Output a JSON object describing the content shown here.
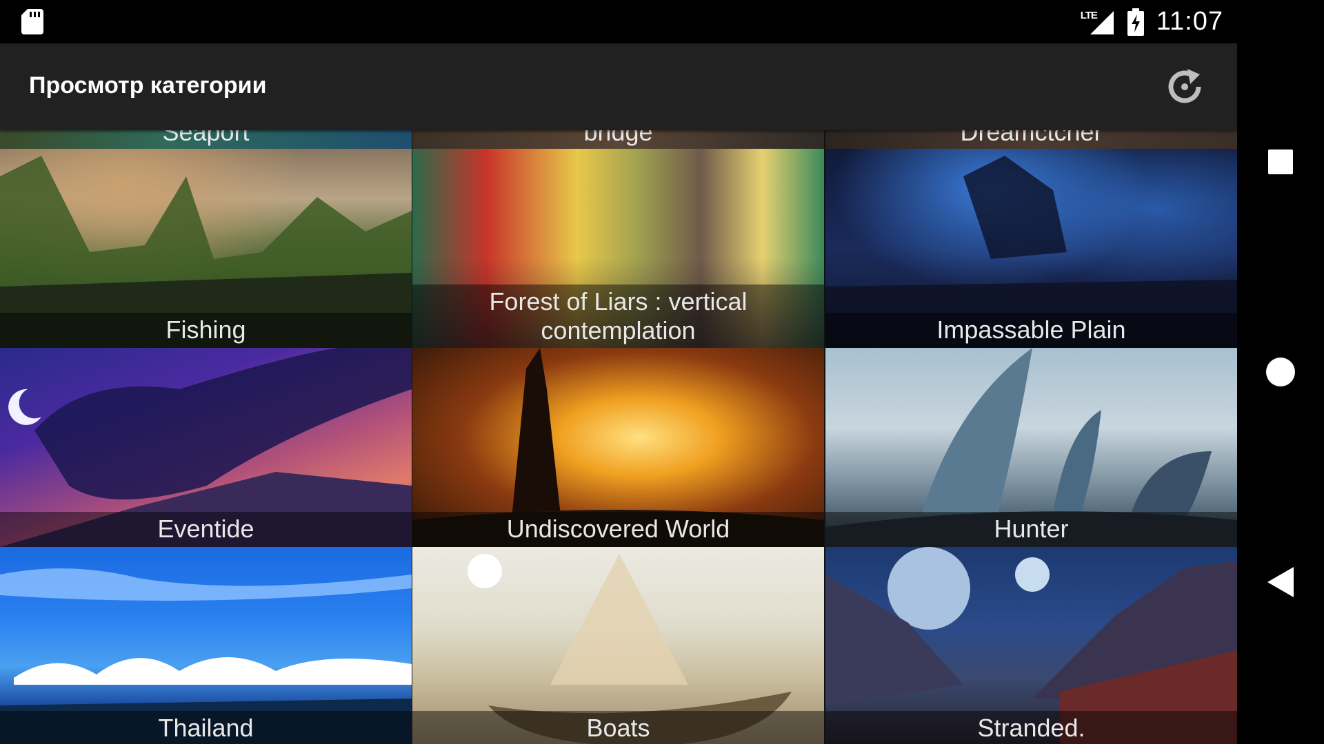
{
  "status_bar": {
    "network": "LTE",
    "time": "11:07"
  },
  "app_bar": {
    "title": "Просмотр категории",
    "refresh_icon": "refresh-icon"
  },
  "top_row_partial": [
    {
      "label": "Seaport"
    },
    {
      "label": "bridge"
    },
    {
      "label": "Dreamctcher"
    }
  ],
  "tiles": [
    {
      "label": "Fishing"
    },
    {
      "label": "Forest of Liars : vertical contemplation"
    },
    {
      "label": "Impassable Plain"
    },
    {
      "label": "Eventide"
    },
    {
      "label": "Undiscovered World"
    },
    {
      "label": "Hunter"
    },
    {
      "label": "Thailand"
    },
    {
      "label": "Boats"
    },
    {
      "label": "Stranded."
    }
  ],
  "nav_bar": {
    "recents_icon": "square-icon",
    "home_icon": "circle-icon",
    "back_icon": "triangle-back-icon"
  }
}
